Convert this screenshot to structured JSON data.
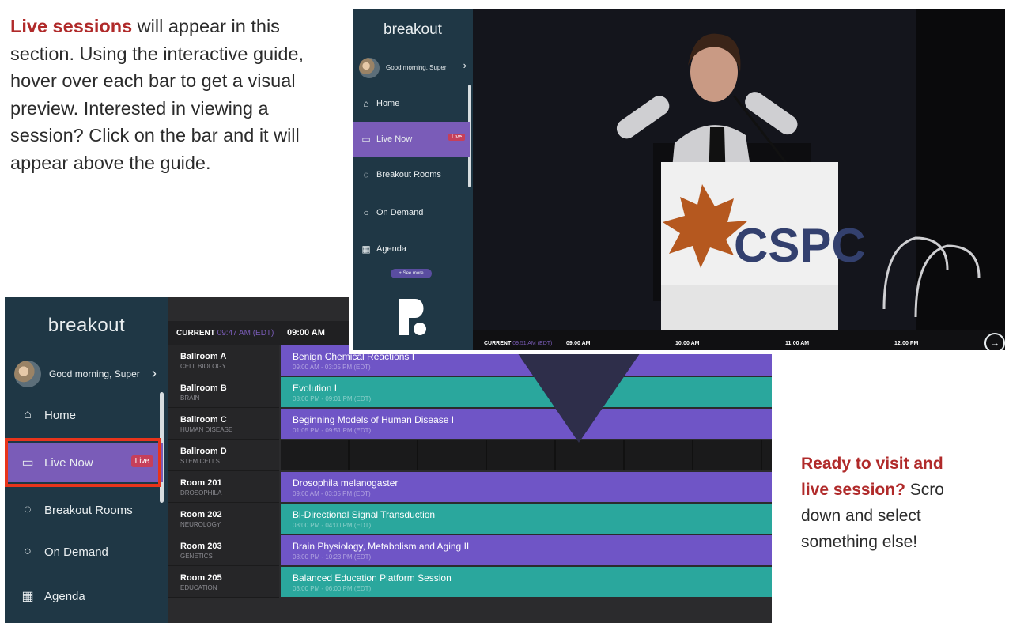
{
  "intro": {
    "highlight": "Live sessions",
    "text": " will appear in this section. Using the interactive guide, hover over each bar to get a visual preview. Interested in viewing a session? Click on the bar and it will appear above the guide."
  },
  "cta": {
    "highlight_line1": "Ready to visit and",
    "highlight_line2": "live session?",
    "rest_line2": " Scro",
    "line3": "down and select",
    "line4": "something else!"
  },
  "app": {
    "brand": "breakout",
    "greeting": "Good morning, Super",
    "nav": [
      {
        "label": "Home",
        "icon": "home-icon"
      },
      {
        "label": "Live Now",
        "icon": "video-icon",
        "badge": "Live"
      },
      {
        "label": "Breakout Rooms",
        "icon": "chat-bubbles-icon"
      },
      {
        "label": "On Demand",
        "icon": "chat-bubble-icon"
      },
      {
        "label": "Agenda",
        "icon": "calendar-icon"
      }
    ],
    "see_more": "+ See more"
  },
  "schedule": {
    "current_label": "CURRENT",
    "current_time": "09:47 AM (EDT)",
    "first_time": "09:00 AM",
    "rows": [
      {
        "room": "Ballroom A",
        "subject": "CELL BIOLOGY",
        "title": "Benign Chemical Reactions I",
        "time": "09:00 AM - 03:05 PM (EDT)",
        "color": "purple"
      },
      {
        "room": "Ballroom B",
        "subject": "BRAIN",
        "title": "Evolution I",
        "time": "08:00 PM - 09:01 PM (EDT)",
        "color": "teal"
      },
      {
        "room": "Ballroom C",
        "subject": "HUMAN DISEASE",
        "title": "Beginning Models of Human Disease I",
        "time": "01:05 PM - 09:51 PM (EDT)",
        "color": "purple"
      },
      {
        "room": "Ballroom D",
        "subject": "STEM CELLS",
        "title": "",
        "time": "",
        "color": "empty"
      },
      {
        "room": "Room 201",
        "subject": "DROSOPHILA",
        "title": "Drosophila melanogaster",
        "time": "09:00 AM - 03:05 PM (EDT)",
        "color": "purple"
      },
      {
        "room": "Room 202",
        "subject": "NEUROLOGY",
        "title": "Bi-Directional Signal Transduction",
        "time": "08:00 PM - 04:00 PM (EDT)",
        "color": "teal"
      },
      {
        "room": "Room 203",
        "subject": "GENETICS",
        "title": "Brain Physiology, Metabolism and Aging II",
        "time": "08:00 PM - 10:23 PM (EDT)",
        "color": "purple"
      },
      {
        "room": "Room 205",
        "subject": "EDUCATION",
        "title": "Balanced Education Platform Session",
        "time": "03:00 PM - 06:00 PM (EDT)",
        "color": "teal"
      }
    ]
  },
  "player": {
    "podium_text": "CSPC",
    "current_label": "CURRENT",
    "current_time": "09:51 AM (EDT)",
    "ticks": [
      "09:00 AM",
      "10:00 AM",
      "11:00 AM",
      "12:00 PM"
    ]
  },
  "colors": {
    "sidebar": "#1f3745",
    "active": "#7a5cb8",
    "purple_session": "#6f55c6",
    "teal_session": "#2aa79d",
    "live_badge": "#c63f5a",
    "accent_text": "#b02a2a",
    "highlight_box": "#e8341b"
  }
}
